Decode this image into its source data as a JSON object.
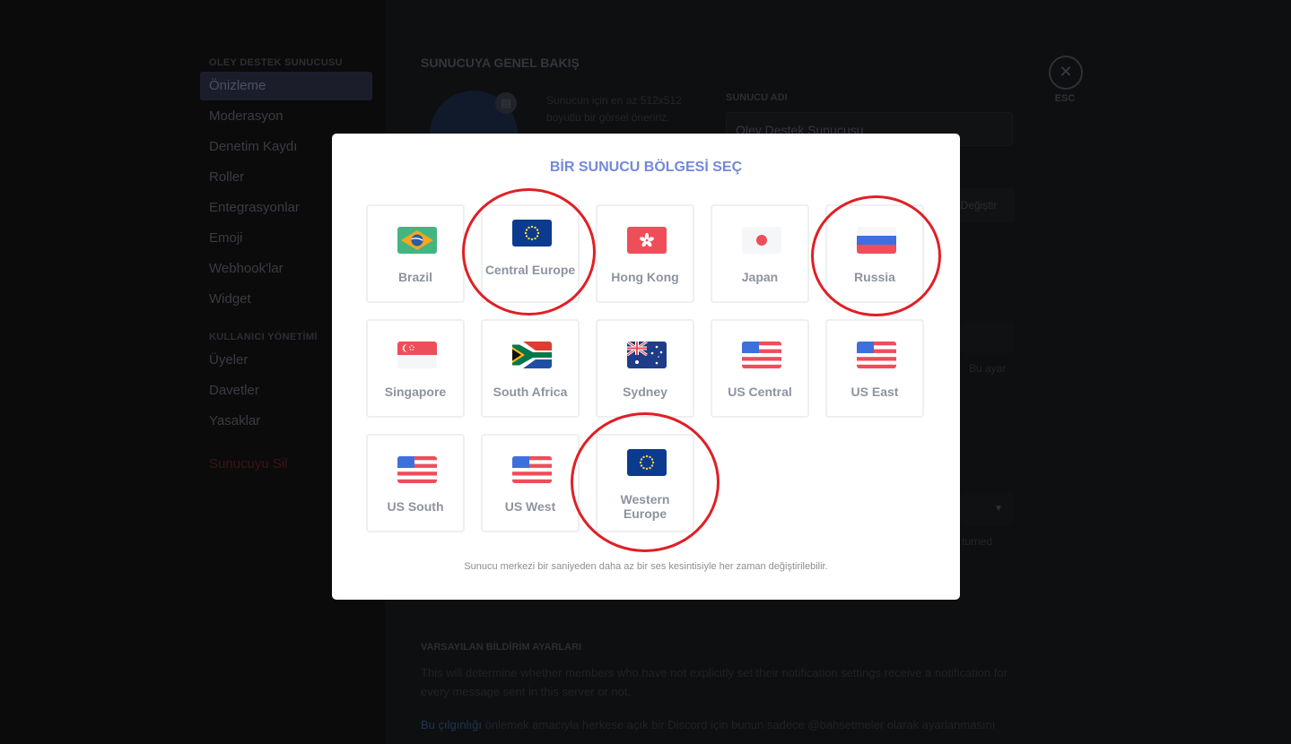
{
  "sidebar": {
    "server_header": "OLEY DESTEK SUNUCUSU",
    "items": [
      "Önizleme",
      "Moderasyon",
      "Denetim Kaydı",
      "Roller",
      "Entegrasyonlar",
      "Emoji",
      "Webhook'lar",
      "Widget"
    ],
    "user_header": "KULLANICI YÖNETİMİ",
    "user_items": [
      "Üyeler",
      "Davetler",
      "Yasaklar"
    ],
    "delete_label": "Sunucuyu Sil"
  },
  "main": {
    "title": "SUNUCUYA GENEL BAKIŞ",
    "avatar_hint": "Sunucun için en az 512x512 boyutlu bir görsel öneririz.",
    "server_name_label": "SUNUCU ADI",
    "server_name_value": "Oley Destek Sunucusu",
    "change_button": "Değiştir",
    "faint_text_1": "Bu ayar",
    "faint_text_2": "turned",
    "notif_title": "VARSAYILAN BİLDİRİM AYARLARI",
    "notif_desc": "This will determine whether members who have not explicitly set their notification settings receive a notification for every message sent in this server or not.",
    "notif_link": "Bu çılgınlığı",
    "notif_link_rest": " önlemek amacıyla herkese açık bir Discord için bunun sadece @bahsetmeler olarak ayarlanmasını"
  },
  "close": {
    "icon": "close-icon",
    "label": "ESC"
  },
  "modal": {
    "title": "BİR SUNUCU BÖLGESİ SEÇ",
    "regions": [
      {
        "label": "Brazil",
        "flag": "br-flag"
      },
      {
        "label": "Central Europe",
        "flag": "eu-flag"
      },
      {
        "label": "Hong Kong",
        "flag": "hk-flag"
      },
      {
        "label": "Japan",
        "flag": "jp-flag"
      },
      {
        "label": "Russia",
        "flag": "ru-flag"
      },
      {
        "label": "Singapore",
        "flag": "sg-flag"
      },
      {
        "label": "South Africa",
        "flag": "za-flag"
      },
      {
        "label": "Sydney",
        "flag": "au-flag"
      },
      {
        "label": "US Central",
        "flag": "us-flag"
      },
      {
        "label": "US East",
        "flag": "us-flag"
      },
      {
        "label": "US South",
        "flag": "us-flag"
      },
      {
        "label": "US West",
        "flag": "us-flag"
      },
      {
        "label": "Western Europe",
        "flag": "eu-flag"
      }
    ],
    "note": "Sunucu merkezi bir saniyeden daha az bir ses kesintisiyle her zaman değiştirilebilir."
  },
  "colors": {
    "accent": "#7289da",
    "highlight_ring": "#e01f26",
    "danger": "#f04747"
  }
}
